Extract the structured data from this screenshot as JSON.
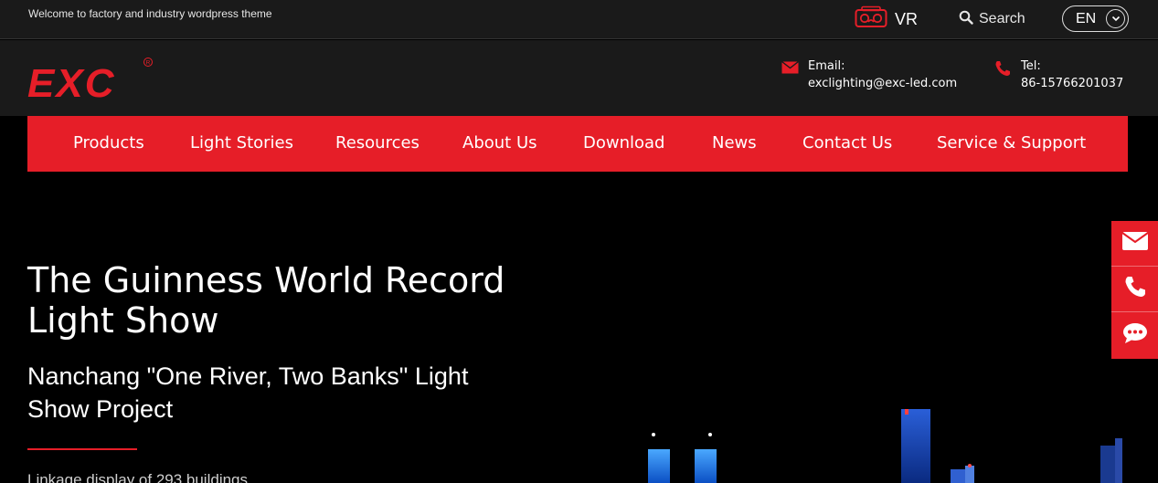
{
  "topbar": {
    "welcome": "Welcome to factory and industry wordpress theme",
    "vr_label": "VR",
    "search_label": "Search",
    "lang_label": "EN"
  },
  "header": {
    "logo_text": "EXC",
    "email_label": "Email:",
    "email_value": "exclighting@exc-led.com",
    "tel_label": "Tel:",
    "tel_value": "86-15766201037"
  },
  "nav": {
    "items": [
      "Products",
      "Light Stories",
      "Resources",
      "About Us",
      "Download",
      "News",
      "Contact Us",
      "Service & Support"
    ]
  },
  "hero": {
    "title": "The Guinness World Record Light Show",
    "subtitle": "Nanchang \"One River, Two Banks\" Light Show Project",
    "description": "Linkage display of 293 buildings"
  },
  "float": {
    "icons": [
      "email-icon",
      "phone-icon",
      "chat-icon"
    ]
  },
  "colors": {
    "brand_red": "#e61e28",
    "header_bg": "#1a1a1a",
    "hero_bg": "#000000"
  }
}
